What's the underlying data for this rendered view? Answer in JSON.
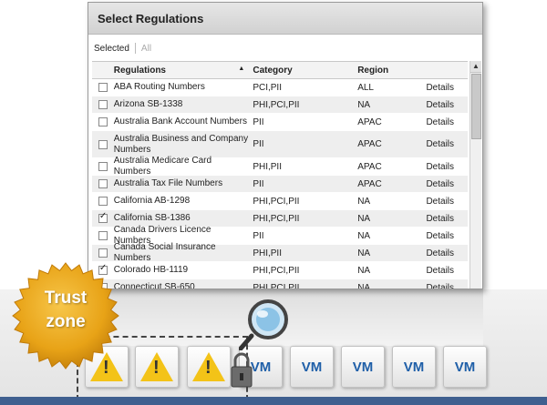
{
  "dialog": {
    "title": "Select Regulations",
    "filter_selected": "Selected",
    "filter_all": "All"
  },
  "table": {
    "headers": {
      "regulations": "Regulations",
      "category": "Category",
      "region": "Region"
    },
    "sort_indicator": "▲",
    "rows": [
      {
        "checked": false,
        "name": "ABA Routing Numbers",
        "category": "PCI,PII",
        "region": "ALL",
        "details": "Details"
      },
      {
        "checked": false,
        "name": "Arizona SB-1338",
        "category": "PHI,PCI,PII",
        "region": "NA",
        "details": "Details"
      },
      {
        "checked": false,
        "name": "Australia Bank Account Numbers",
        "category": "PII",
        "region": "APAC",
        "details": "Details"
      },
      {
        "checked": false,
        "name": "Australia Business and Company Numbers",
        "category": "PII",
        "region": "APAC",
        "details": "Details"
      },
      {
        "checked": false,
        "name": "Australia Medicare Card Numbers",
        "category": "PHI,PII",
        "region": "APAC",
        "details": "Details"
      },
      {
        "checked": false,
        "name": "Australia Tax File Numbers",
        "category": "PII",
        "region": "APAC",
        "details": "Details"
      },
      {
        "checked": false,
        "name": "California AB-1298",
        "category": "PHI,PCI,PII",
        "region": "NA",
        "details": "Details"
      },
      {
        "checked": true,
        "name": "California SB-1386",
        "category": "PHI,PCI,PII",
        "region": "NA",
        "details": "Details"
      },
      {
        "checked": false,
        "name": "Canada Drivers Licence Numbers",
        "category": "PII",
        "region": "NA",
        "details": "Details"
      },
      {
        "checked": false,
        "name": "Canada Social Insurance Numbers",
        "category": "PHI,PII",
        "region": "NA",
        "details": "Details"
      },
      {
        "checked": true,
        "name": "Colorado HB-1119",
        "category": "PHI,PCI,PII",
        "region": "NA",
        "details": "Details"
      },
      {
        "checked": false,
        "name": "Connecticut SB-650",
        "category": "PHI,PCI,PII",
        "region": "NA",
        "details": "Details"
      }
    ]
  },
  "graphic": {
    "seal_line1": "Trust",
    "seal_line2": "zone",
    "vm_label": "VM",
    "vm_boxes": [
      {
        "kind": "warning",
        "icon": "warning-icon"
      },
      {
        "kind": "warning",
        "icon": "warning-icon"
      },
      {
        "kind": "warning",
        "icon": "warning-icon"
      },
      {
        "kind": "vm",
        "label": "VM"
      },
      {
        "kind": "vm",
        "label": "VM"
      },
      {
        "kind": "vm",
        "label": "VM"
      },
      {
        "kind": "vm",
        "label": "VM"
      },
      {
        "kind": "vm",
        "label": "VM"
      }
    ],
    "colors": {
      "vm_text": "#1f5fa8",
      "seal_gold": "#e8a317",
      "warning_yellow": "#f3c318",
      "bottom_bar": "#3f5f8f"
    }
  }
}
